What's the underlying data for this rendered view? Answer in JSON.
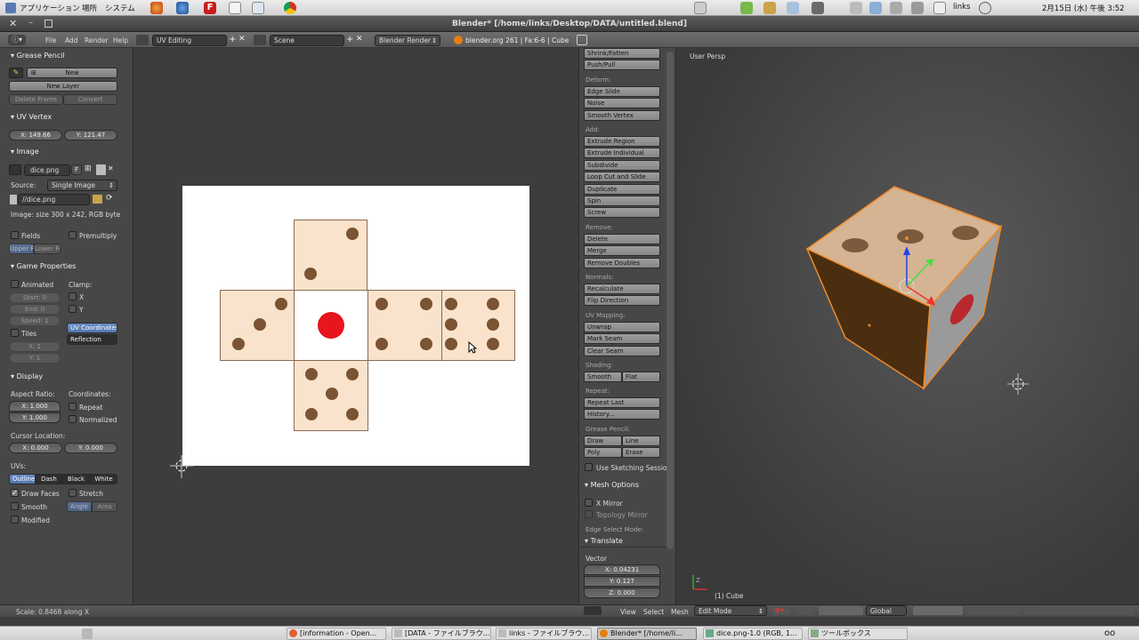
{
  "os_bar": {
    "menus": [
      "アプリケーション",
      "場所",
      "システム"
    ],
    "user": "links",
    "clock": "2月15日 (水) 午後 3:52"
  },
  "window": {
    "title": "Blender* [/home/links/Desktop/DATA/untitled.blend]"
  },
  "info_header": {
    "menus": [
      "File",
      "Add",
      "Render",
      "Help"
    ],
    "layout": "UV Editing",
    "scene": "Scene",
    "engine": "Blender Render",
    "stats": "blender.org 261 | Fa:6-6 | Cube"
  },
  "left_panel": {
    "grease_pencil": {
      "title": "Grease Pencil",
      "new": "New",
      "new_layer": "New Layer",
      "delete_frame": "Delete Frame",
      "convert": "Convert"
    },
    "uv_vertex": {
      "title": "UV Vertex",
      "x": "X: 149.66",
      "y": "Y: 121.47"
    },
    "image": {
      "title": "Image",
      "name": "dice.png",
      "f": "F",
      "source_label": "Source:",
      "source": "Single Image",
      "path": "//dice.png",
      "info": "Image: size 300 x 242, RGB byte",
      "fields": "Fields",
      "premultiply": "Premultiply",
      "upper": "Upper Fi",
      "lower": "Lower Fi"
    },
    "game_properties": {
      "title": "Game Properties",
      "animated": "Animated",
      "clamp": "Clamp:",
      "start": "Start: 0",
      "end": "End: 0",
      "speed": "Speed: 1",
      "x": "X",
      "y": "Y",
      "tiles": "Tiles",
      "tx": "X: 1",
      "ty": "Y: 1",
      "uv_coordinates": "UV Coordinates",
      "reflection": "Reflection"
    },
    "display": {
      "title": "Display",
      "aspect_label": "Aspect Ratio:",
      "coords_label": "Coordinates:",
      "ax": "X: 1.000",
      "ay": "Y: 1.000",
      "repeat": "Repeat",
      "normalized": "Normalized",
      "cursor_label": "Cursor Location:",
      "cx": "X: 0.000",
      "cy": "Y: 0.000",
      "uvs_label": "UVs:",
      "outline": "Outline",
      "dash": "Dash",
      "black": "Black",
      "white": "White",
      "draw_faces": "Draw Faces",
      "stretch": "Stretch",
      "smooth": "Smooth",
      "angle": "Angle",
      "area": "Area",
      "modified": "Modified"
    },
    "status": "Scale: 0.8468 along X"
  },
  "tool_panel": {
    "top_buttons": [
      "Shrink/Fatten",
      "Push/Pull"
    ],
    "deform_label": "Deform:",
    "deform": [
      "Edge Slide",
      "Noise",
      "Smooth Vertex"
    ],
    "add_label": "Add:",
    "add": [
      "Extrude Region",
      "Extrude Individual",
      "Subdivide",
      "Loop Cut and Slide",
      "Duplicate",
      "Spin",
      "Screw"
    ],
    "remove_label": "Remove:",
    "remove": [
      "Delete",
      "Merge",
      "Remove Doubles"
    ],
    "normals_label": "Normals:",
    "normals": [
      "Recalculate",
      "Flip Direction"
    ],
    "uv_label": "UV Mapping:",
    "uv": [
      "Unwrap",
      "Mark Seam",
      "Clear Seam"
    ],
    "shading_label": "Shading:",
    "smooth": "Smooth",
    "flat": "Flat",
    "repeat_label": "Repeat:",
    "repeat": [
      "Repeat Last",
      "History..."
    ],
    "gp_label": "Grease Pencil:",
    "draw": "Draw",
    "line": "Line",
    "poly": "Poly",
    "erase": "Erase",
    "sketching": "Use Sketching Sessio",
    "mesh_options": "Mesh Options",
    "x_mirror": "X Mirror",
    "topology_mirror": "Topology Mirror",
    "edge_select": "Edge Select Mode:",
    "translate": "Translate",
    "vector_label": "Vector",
    "vx": "X: 0.04231",
    "vy": "Y: 0.127",
    "vz": "Z: 0.000"
  },
  "viewport": {
    "label": "User Persp",
    "object": "(1) Cube",
    "footer": [
      "View",
      "Select",
      "Mesh"
    ],
    "mode": "Edit Mode",
    "orientation": "Global"
  },
  "taskbar": {
    "items": [
      "[information - Open...",
      "[DATA - ファイルブラウ...",
      "links - ファイルブラウ...",
      "Blender* [/home/li...",
      "dice.png-1.0 (RGB, 1...",
      "ツールボックス"
    ]
  },
  "colors": {
    "face": "#fae3cc",
    "dot": "#7a5433",
    "red": "#e8141e",
    "cube_edge": "#f08a2a"
  }
}
